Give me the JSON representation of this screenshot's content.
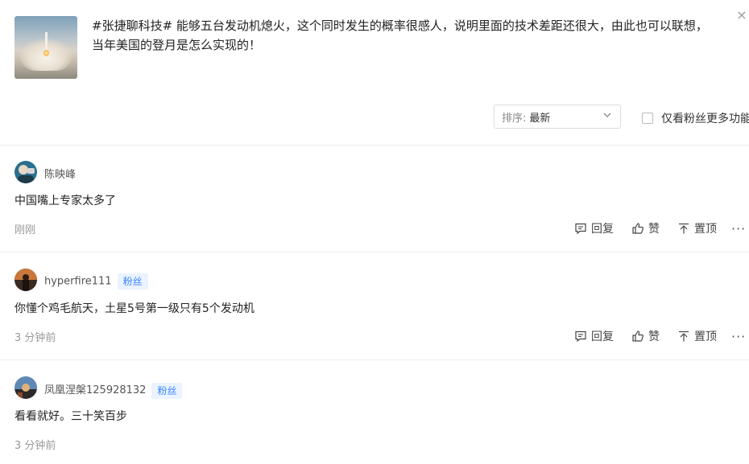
{
  "close_label": "×",
  "post": {
    "text_line1": "#张捷聊科技# 能够五台发动机熄火，这个同时发生的概率很感人，说明里面的技术差距还很大，由此也可以联想，",
    "text_line2": "当年美国的登月是怎么实现的！"
  },
  "sort": {
    "label": "排序:",
    "value": "最新"
  },
  "filter": {
    "label": "仅看粉丝更多功能"
  },
  "actions": {
    "reply": "回复",
    "like": "赞",
    "pin": "置顶",
    "more": "···"
  },
  "comments": [
    {
      "name": "陈映峰",
      "badge": "",
      "content": "中国嘴上专家太多了",
      "time": "刚刚"
    },
    {
      "name": "hyperfire111",
      "badge": "粉丝",
      "content": "你懂个鸡毛航天，土星5号第一级只有5个发动机",
      "time": "3 分钟前"
    },
    {
      "name": "凤凰涅槃125928132",
      "badge": "粉丝",
      "content": "看看就好。三十笑百步",
      "time": "3 分钟前"
    }
  ]
}
